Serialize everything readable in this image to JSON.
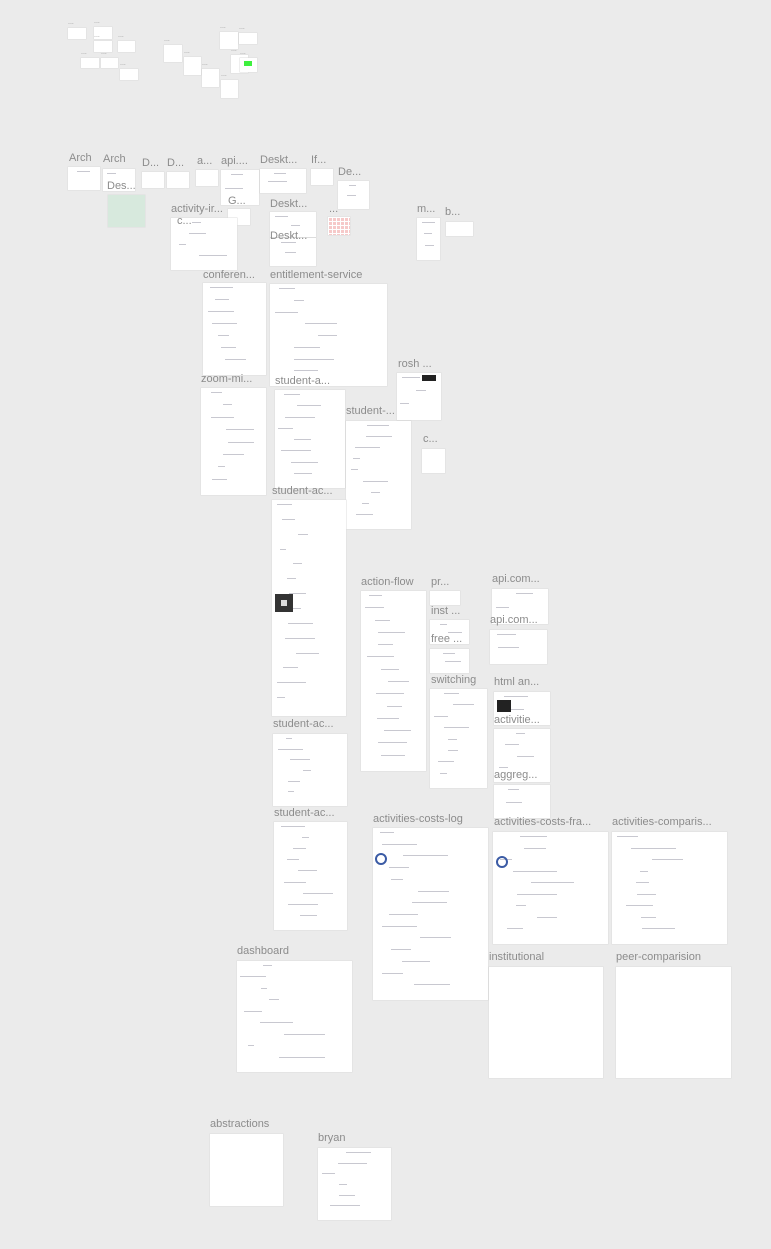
{
  "canvas": {
    "background": "#ebebeb",
    "frames": [
      {
        "label": "Arch"
      },
      {
        "label": "Arch"
      },
      {
        "label": "Des...",
        "color": "#d7e9dd"
      },
      {
        "label": "D..."
      },
      {
        "label": "D..."
      },
      {
        "label": "a..."
      },
      {
        "label": "api...."
      },
      {
        "label": "Deskt..."
      },
      {
        "label": "If..."
      },
      {
        "label": "De..."
      },
      {
        "label": "G..."
      },
      {
        "label": "activity-ir..."
      },
      {
        "label": "Deskt..."
      },
      {
        "label": "Deskt..."
      },
      {
        "label": "...",
        "color": "#f6c9c9"
      },
      {
        "label": "m..."
      },
      {
        "label": "b..."
      },
      {
        "label": "conferen..."
      },
      {
        "label": "entitlement-service"
      },
      {
        "label": "zoom-mi..."
      },
      {
        "label": "student-a..."
      },
      {
        "label": "rosh ..."
      },
      {
        "label": "student-..."
      },
      {
        "label": "c..."
      },
      {
        "label": "student-ac..."
      },
      {
        "label": "action-flow"
      },
      {
        "label": "pr..."
      },
      {
        "label": "inst ..."
      },
      {
        "label": "free ..."
      },
      {
        "label": "switching"
      },
      {
        "label": "api.com..."
      },
      {
        "label": "api.com..."
      },
      {
        "label": "html an..."
      },
      {
        "label": "activitie..."
      },
      {
        "label": "aggreg..."
      },
      {
        "label": "student-ac..."
      },
      {
        "label": "student-ac..."
      },
      {
        "label": "activities-costs-log"
      },
      {
        "label": "activities-costs-fra..."
      },
      {
        "label": "activities-comparis..."
      },
      {
        "label": "dashboard"
      },
      {
        "label": "institutional"
      },
      {
        "label": "peer-comparision"
      },
      {
        "label": "abstractions"
      },
      {
        "label": "bryan"
      }
    ],
    "nested_labels": [
      {
        "label": "c..."
      }
    ],
    "mini_frames": [
      {
        "label": "..."
      },
      {
        "label": "..."
      },
      {
        "label": "..."
      },
      {
        "label": "..."
      },
      {
        "label": "..."
      },
      {
        "label": "..."
      },
      {
        "label": "..."
      },
      {
        "label": "..."
      },
      {
        "label": "..."
      },
      {
        "label": "..."
      },
      {
        "label": "..."
      },
      {
        "label": "..."
      },
      {
        "label": "..."
      },
      {
        "label": "..."
      },
      {
        "label": "..."
      }
    ]
  }
}
